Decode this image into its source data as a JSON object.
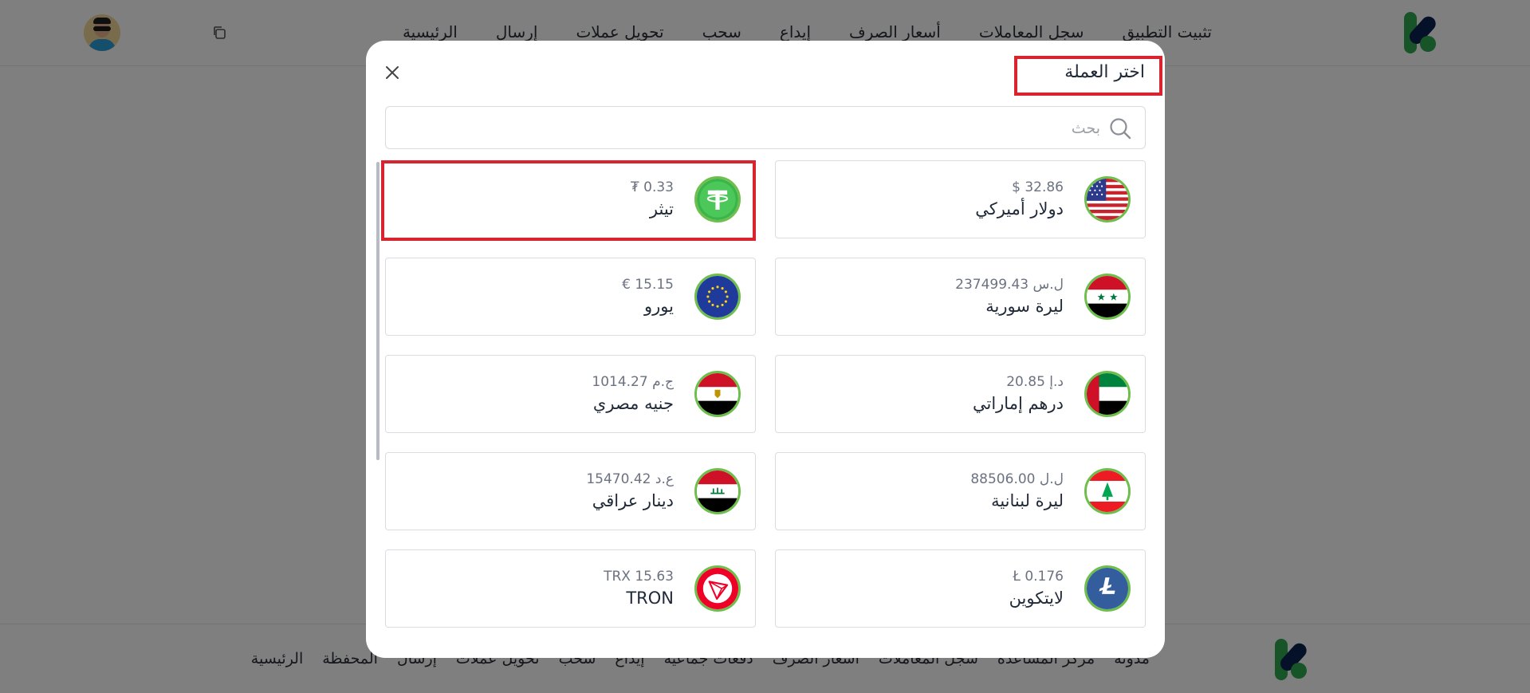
{
  "header": {
    "nav": [
      "الرئيسية",
      "إرسال",
      "تحويل عملات",
      "سحب",
      "إيداع",
      "أسعار الصرف",
      "سجل المعاملات",
      "تثبيت التطبيق"
    ]
  },
  "footer": {
    "nav": [
      "الرئيسية",
      "المحفظة",
      "إرسال",
      "تحويل عملات",
      "سحب",
      "إيداع",
      "دفعات جماعية",
      "أسعار الصرف",
      "سجل المعاملات",
      "مركز المساعدة",
      "مدونة"
    ]
  },
  "modal": {
    "title": "اختر العملة",
    "search_placeholder": "بحث",
    "currencies": [
      {
        "name": "دولار أميركي",
        "amount": "$ 32.86",
        "icon": "us-flag-icon"
      },
      {
        "name": "تيثر",
        "amount": "₮ 0.33",
        "icon": "tether-icon",
        "selected": true
      },
      {
        "name": "ليرة سورية",
        "amount": "237499.43 ل.س",
        "icon": "syria-flag-icon"
      },
      {
        "name": "يورو",
        "amount": "€ 15.15",
        "icon": "eu-flag-icon"
      },
      {
        "name": "درهم إماراتي",
        "amount": "20.85 د.إ",
        "icon": "uae-flag-icon"
      },
      {
        "name": "جنيه مصري",
        "amount": "1014.27 ج.م",
        "icon": "egypt-flag-icon"
      },
      {
        "name": "ليرة لبنانية",
        "amount": "88506.00 ل.ل",
        "icon": "lebanon-flag-icon"
      },
      {
        "name": "دينار عراقي",
        "amount": "15470.42 ع.د",
        "icon": "iraq-flag-icon"
      },
      {
        "name": "لايتكوين",
        "amount": "Ł 0.176",
        "icon": "litecoin-icon"
      },
      {
        "name": "TRON",
        "amount": "TRX 15.63",
        "icon": "tron-icon"
      }
    ]
  },
  "colors": {
    "accent_green": "#2fa84f",
    "brand_navy": "#0b2352",
    "highlight_red": "#d9232e"
  }
}
